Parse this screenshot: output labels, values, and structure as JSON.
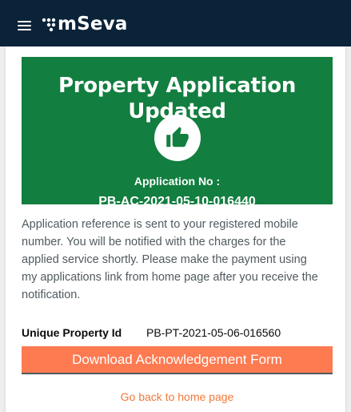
{
  "header": {
    "brand": "mSeva",
    "menu_icon": "hamburger-menu-icon",
    "logo_icon": "mseva-logo-icon",
    "bg_color": "#0b2339"
  },
  "banner": {
    "title": "Property Application Updated",
    "icon": "thumbs-up-icon",
    "application_no_label": "Application No :",
    "application_no": "PB-AC-2021-05-10-016440",
    "bg_color": "#127e3f"
  },
  "message": "Application reference is sent to your registered mobile number. You will be notified with the charges for the applied service shortly. Please make the payment using my applications link from home page after you receive the notification.",
  "property": {
    "label": "Unique Property Id",
    "value": "PB-PT-2021-05-06-016560"
  },
  "actions": {
    "download_label": "Download Acknowledgement Form",
    "home_link_label": "Go back to home page",
    "accent_color": "#fe7a51"
  }
}
